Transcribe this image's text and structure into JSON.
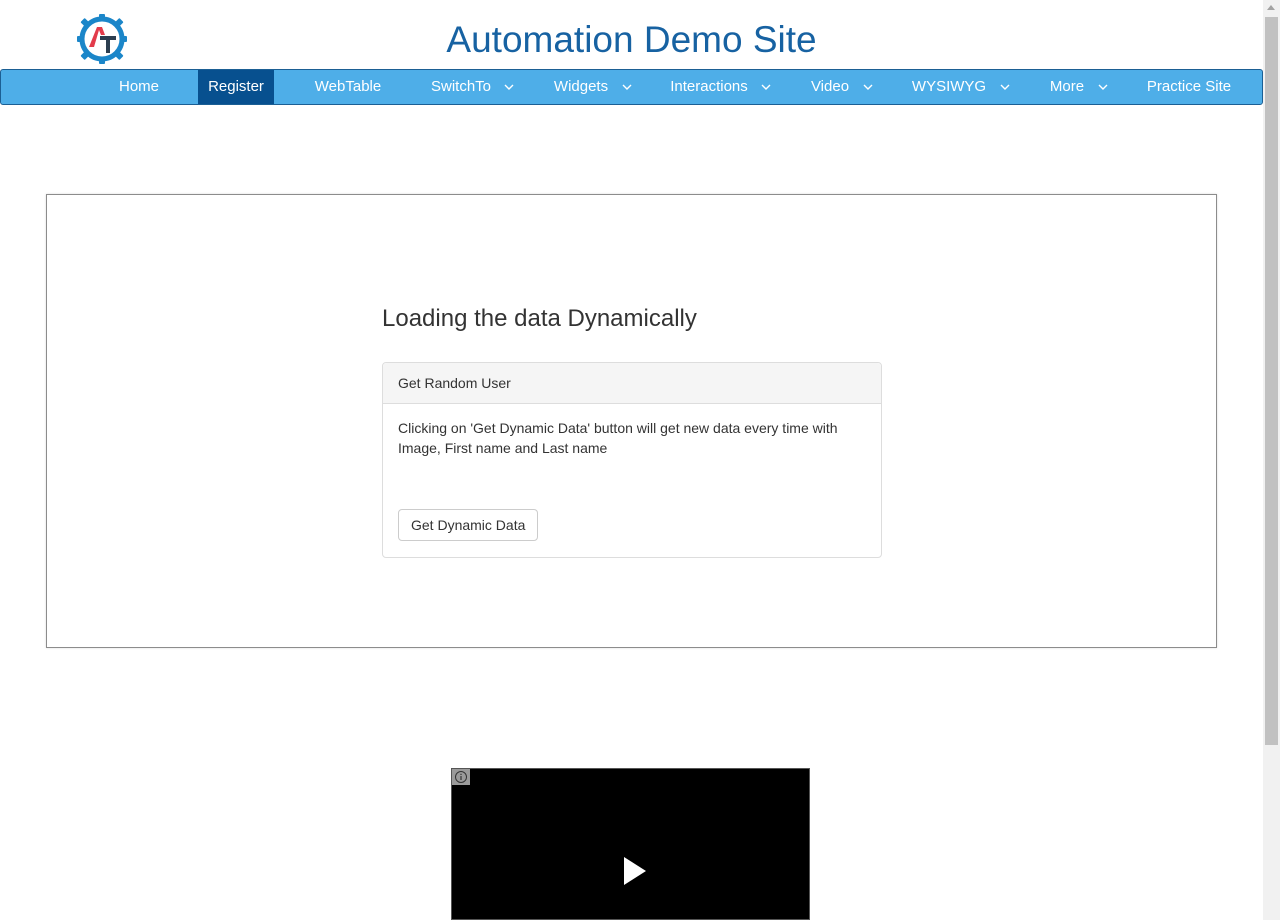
{
  "header": {
    "site_title": "Automation Demo Site",
    "logo_icon": "automation-testing-gear-logo",
    "logo_colors": {
      "gear": "#1b86c9",
      "a": "#e23b4b",
      "t": "#2c3e50"
    }
  },
  "nav": {
    "bar_color": "#4eaee8",
    "active_color": "#07508f",
    "items": [
      {
        "label": "Home",
        "dropdown": false,
        "active": false
      },
      {
        "label": "Register",
        "dropdown": false,
        "active": true
      },
      {
        "label": "WebTable",
        "dropdown": false,
        "active": false
      },
      {
        "label": "SwitchTo",
        "dropdown": true,
        "active": false
      },
      {
        "label": "Widgets",
        "dropdown": true,
        "active": false
      },
      {
        "label": "Interactions",
        "dropdown": true,
        "active": false
      },
      {
        "label": "Video",
        "dropdown": true,
        "active": false
      },
      {
        "label": "WYSIWYG",
        "dropdown": true,
        "active": false
      },
      {
        "label": "More",
        "dropdown": true,
        "active": false
      },
      {
        "label": "Practice Site",
        "dropdown": false,
        "active": false
      }
    ]
  },
  "main": {
    "heading": "Loading the data Dynamically",
    "panel": {
      "title": "Get Random User",
      "body": "Clicking on 'Get Dynamic Data' button will get new data every time with Image, First name and Last name",
      "button_label": "Get Dynamic Data"
    }
  },
  "video": {
    "info_icon": "info-icon",
    "play_icon": "play-icon"
  }
}
